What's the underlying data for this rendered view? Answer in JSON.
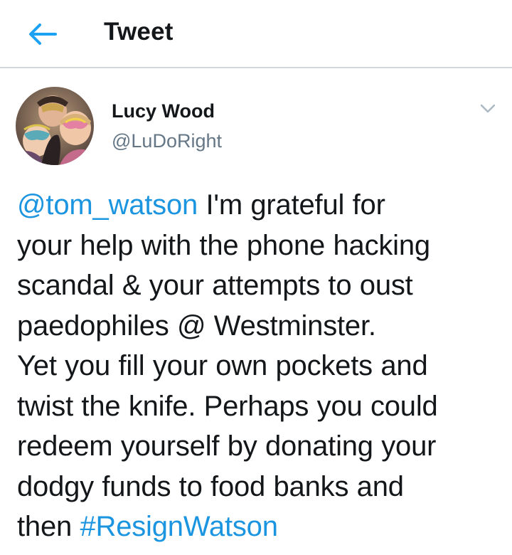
{
  "header": {
    "title": "Tweet",
    "back_icon": "arrow-left-icon",
    "accent_color": "#1da1f2"
  },
  "tweet": {
    "author": {
      "name": "Lucy Wood",
      "handle": "@LuDoRight"
    },
    "menu_icon": "chevron-down-icon",
    "mention": "@tom_watson",
    "text_lines": [
      " I'm grateful for",
      "your help with the phone hacking",
      "scandal & your attempts to oust",
      "paedophiles @ Westminster.",
      "Yet you fill your own pockets and",
      "twist the knife. Perhaps you could",
      "redeem yourself by donating your",
      "dodgy funds to food banks and",
      "then "
    ],
    "hashtag": "#ResignWatson",
    "link_color": "#1b95e0"
  }
}
